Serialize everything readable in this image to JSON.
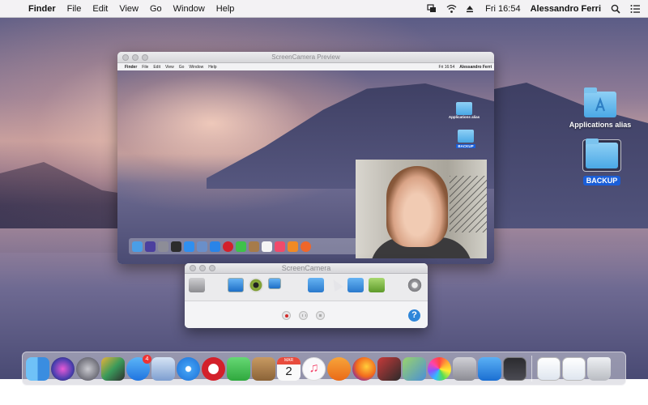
{
  "menubar": {
    "app_name": "Finder",
    "menus": [
      "File",
      "Edit",
      "View",
      "Go",
      "Window",
      "Help"
    ],
    "clock": "Fri 16:54",
    "user": "Alessandro Ferri"
  },
  "desktop": {
    "icons": [
      {
        "label": "Applications alias",
        "icon": "folder-icon"
      },
      {
        "label": "BACKUP",
        "icon": "folder-icon"
      }
    ]
  },
  "preview_window": {
    "title": "ScreenCamera Preview",
    "mini_menubar": {
      "app_name": "Finder",
      "menus": [
        "File",
        "Edit",
        "View",
        "Go",
        "Window",
        "Help"
      ],
      "clock": "Fri 16:54",
      "user": "Alessandro Ferri"
    },
    "mini_icons": [
      {
        "label": "Applications alias"
      },
      {
        "label": "BACKUP"
      }
    ]
  },
  "control_panel": {
    "title": "ScreenCamera",
    "help_label": "?"
  },
  "dock": {
    "app_store_badge": "4",
    "calendar_month": "MAR",
    "calendar_day": "2"
  }
}
